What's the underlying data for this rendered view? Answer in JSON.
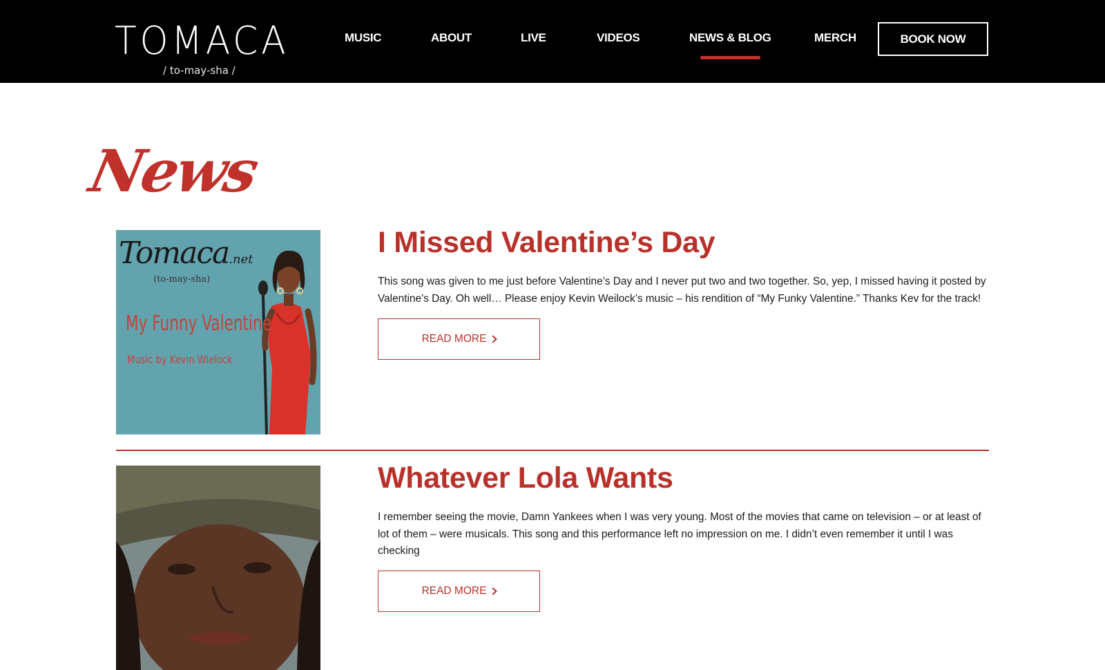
{
  "header": {
    "logo": {
      "wordmark": "TOMACA",
      "pronunciation": "/ to-may-sha /"
    },
    "nav": [
      {
        "label": "MUSIC",
        "active": false
      },
      {
        "label": "ABOUT",
        "active": false
      },
      {
        "label": "LIVE",
        "active": false
      },
      {
        "label": "VIDEOS",
        "active": false
      },
      {
        "label": "NEWS & BLOG",
        "active": true
      },
      {
        "label": "MERCH",
        "active": false
      }
    ],
    "book_button": "BOOK NOW"
  },
  "page": {
    "heading": "News"
  },
  "colors": {
    "accent": "#c0312b",
    "header_bg": "#000000"
  },
  "posts": [
    {
      "title": "I Missed Valentine’s Day",
      "excerpt": "This song was given to me just before Valentine’s Day and I never put two and two together.  So, yep, I missed having it posted by Valentine’s Day.  Oh well…  Please enjoy Kevin Weilock’s music – his rendition of “My Funky Valentine.”  Thanks Kev for the track!",
      "read_more": "READ MORE",
      "thumbnail": {
        "brand": "Tomaca",
        "brand_suffix": ".net",
        "pronunciation": "(to-may-sha)",
        "song": "My Funny Valentine",
        "credit": "Music by Kevin Wielock"
      }
    },
    {
      "title": "Whatever Lola Wants",
      "excerpt": "I remember seeing the movie, Damn Yankees when I was very young.  Most of the movies that came on television – or at least of lot of them – were musicals. This song and this performance left no impression on me.  I didn’t even remember it until I was checking",
      "read_more": "READ MORE"
    }
  ]
}
